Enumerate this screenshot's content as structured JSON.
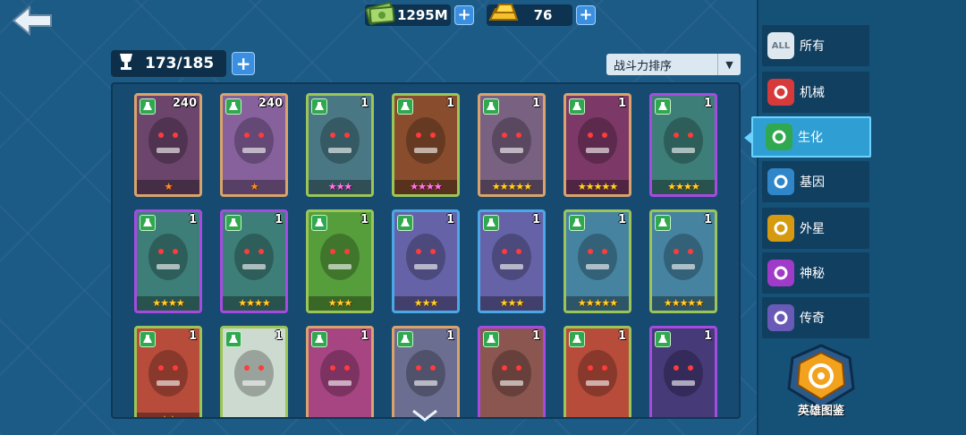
{
  "currency": {
    "cash": "1295M",
    "gold": "76",
    "plus_label": "+"
  },
  "roster": {
    "capacity": "173/185",
    "plus_label": "+"
  },
  "sort": {
    "selected": "战斗力排序"
  },
  "sidebar": {
    "items": [
      {
        "label": "所有",
        "icon": "all-icon",
        "icon_text": "ALL"
      },
      {
        "label": "机械",
        "icon": "mech-icon"
      },
      {
        "label": "生化",
        "icon": "biohazard-icon"
      },
      {
        "label": "基因",
        "icon": "dna-icon"
      },
      {
        "label": "外星",
        "icon": "alien-icon"
      },
      {
        "label": "神秘",
        "icon": "mystery-icon"
      },
      {
        "label": "传奇",
        "icon": "legend-icon"
      }
    ],
    "active_index": 2,
    "codex_label": "英雄图鉴"
  },
  "cards": [
    {
      "count": "240",
      "stars": "★",
      "frame": "orange",
      "color": "#5b3a70"
    },
    {
      "count": "240",
      "stars": "★",
      "frame": "orange",
      "color": "#7a5aa8"
    },
    {
      "count": "1",
      "stars": "★★★",
      "frame": "green",
      "color": "#3e6d8f"
    },
    {
      "count": "1",
      "stars": "★★★★",
      "frame": "green",
      "color": "#8a3b2a"
    },
    {
      "count": "1",
      "stars": "★★★★★",
      "frame": "orange",
      "color": "#6b5a8a"
    },
    {
      "count": "1",
      "stars": "★★★★★",
      "frame": "orange",
      "color": "#6e2a6a"
    },
    {
      "count": "1",
      "stars": "★★★★",
      "frame": "purple",
      "color": "#2f8a6a"
    },
    {
      "count": "1",
      "stars": "★★★★",
      "frame": "purple",
      "color": "#2f8a6a"
    },
    {
      "count": "1",
      "stars": "★★★★",
      "frame": "purple",
      "color": "#2f8a6a"
    },
    {
      "count": "1",
      "stars": "★★★",
      "frame": "green",
      "color": "#4e9a3a"
    },
    {
      "count": "1",
      "stars": "★★★",
      "frame": "blue",
      "color": "#6e5aa0"
    },
    {
      "count": "1",
      "stars": "★★★",
      "frame": "blue",
      "color": "#6e5aa0"
    },
    {
      "count": "1",
      "stars": "★★★★★",
      "frame": "green",
      "color": "#3a7ab0"
    },
    {
      "count": "1",
      "stars": "★★★★★",
      "frame": "green",
      "color": "#3a7ab0"
    },
    {
      "count": "1",
      "stars": "★★",
      "frame": "green",
      "color": "#c03a3a"
    },
    {
      "count": "1",
      "stars": "",
      "frame": "green",
      "color": "#d8e0e8"
    },
    {
      "count": "1",
      "stars": "",
      "frame": "orange",
      "color": "#a03a8a"
    },
    {
      "count": "1",
      "stars": "",
      "frame": "orange",
      "color": "#5a6a9a"
    },
    {
      "count": "1",
      "stars": "",
      "frame": "purple",
      "color": "#8a5a3a"
    },
    {
      "count": "1",
      "stars": "",
      "frame": "green",
      "color": "#c03a3a"
    },
    {
      "count": "1",
      "stars": "",
      "frame": "purple",
      "color": "#3a3a6a"
    }
  ]
}
